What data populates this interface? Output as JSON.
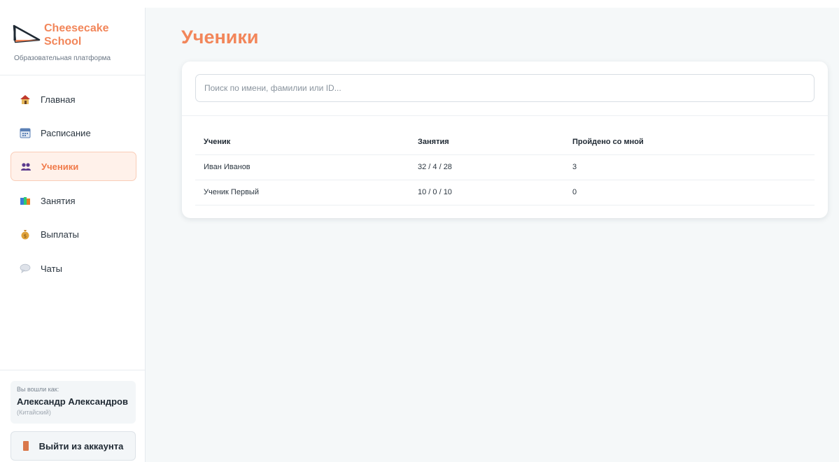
{
  "brand": {
    "name": "Cheesecake School",
    "subtitle": "Образовательная платформа",
    "accent": "#f2865a"
  },
  "nav": {
    "items": [
      {
        "label": "Главная",
        "icon": "home-icon"
      },
      {
        "label": "Расписание",
        "icon": "calendar-icon"
      },
      {
        "label": "Ученики",
        "icon": "users-icon",
        "active": true
      },
      {
        "label": "Занятия",
        "icon": "books-icon"
      },
      {
        "label": "Выплаты",
        "icon": "money-bag-icon"
      },
      {
        "label": "Чаты",
        "icon": "chat-icon"
      }
    ]
  },
  "user": {
    "label": "Вы вошли как:",
    "name": "Александр Александров",
    "language": "(Китайский)"
  },
  "logout": {
    "label": "Выйти из аккаунта",
    "icon": "door-icon"
  },
  "page": {
    "title": "Ученики"
  },
  "search": {
    "placeholder": "Поиск по имени, фамилии или ID...",
    "value": ""
  },
  "table": {
    "headers": [
      "Ученик",
      "Занятия",
      "Пройдено со мной"
    ],
    "rows": [
      [
        "Иван Иванов",
        "32 / 4 / 28",
        "3"
      ],
      [
        "Ученик Первый",
        "10 / 0 / 10",
        "0"
      ]
    ]
  }
}
